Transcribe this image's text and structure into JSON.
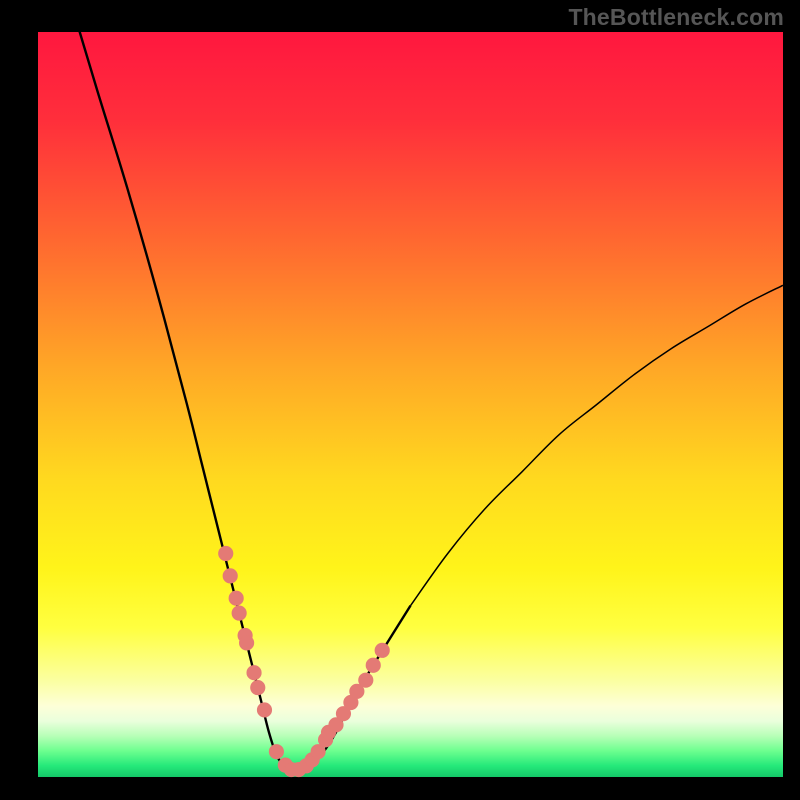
{
  "watermark": {
    "text": "TheBottleneck.com"
  },
  "colors": {
    "background": "#000000",
    "gradient_stops": [
      {
        "pos": 0.0,
        "color": "#ff173f"
      },
      {
        "pos": 0.12,
        "color": "#ff2f3b"
      },
      {
        "pos": 0.28,
        "color": "#ff6830"
      },
      {
        "pos": 0.45,
        "color": "#ffa726"
      },
      {
        "pos": 0.6,
        "color": "#ffd91f"
      },
      {
        "pos": 0.72,
        "color": "#fff41a"
      },
      {
        "pos": 0.8,
        "color": "#ffff40"
      },
      {
        "pos": 0.87,
        "color": "#fbffa0"
      },
      {
        "pos": 0.905,
        "color": "#fdffd8"
      },
      {
        "pos": 0.925,
        "color": "#eaffdc"
      },
      {
        "pos": 0.945,
        "color": "#b7ffb7"
      },
      {
        "pos": 0.965,
        "color": "#6dff8f"
      },
      {
        "pos": 0.985,
        "color": "#25e97a"
      },
      {
        "pos": 1.0,
        "color": "#14c768"
      }
    ],
    "curve": "#000000",
    "marker_fill": "#e47a75",
    "marker_stroke": "#e47a75"
  },
  "chart_data": {
    "type": "line",
    "title": "",
    "xlabel": "",
    "ylabel": "",
    "xlim": [
      0,
      100
    ],
    "ylim": [
      0,
      100
    ],
    "grid": false,
    "legend": false,
    "series": [
      {
        "name": "bottleneck-curve",
        "x": [
          5,
          8,
          12,
          16,
          20,
          22,
          24,
          26,
          28,
          29,
          30,
          31,
          32,
          33,
          34,
          35,
          36,
          38,
          40,
          42,
          45,
          50,
          55,
          60,
          65,
          70,
          75,
          80,
          85,
          90,
          95,
          100
        ],
        "y": [
          102,
          92,
          79,
          65,
          50,
          42,
          34,
          26,
          18,
          14,
          10,
          6,
          3,
          1.5,
          1,
          1,
          1.5,
          3,
          6,
          10,
          15,
          23,
          30,
          36,
          41,
          46,
          50,
          54,
          57.5,
          60.5,
          63.5,
          66
        ],
        "note": "y is the curve height as percent of plot-area height measured from the bottom; values are visual estimates"
      }
    ],
    "markers": {
      "name": "highlighted-points",
      "x": [
        25.2,
        25.8,
        26.6,
        27.0,
        27.8,
        28.0,
        29.0,
        29.5,
        30.4,
        32.0,
        33.2,
        34.0,
        35.0,
        36.0,
        36.8,
        37.6,
        38.6,
        39.0,
        40.0,
        41.0,
        42.0,
        42.8,
        44.0,
        45.0,
        46.2
      ],
      "y": [
        30.0,
        27.0,
        24.0,
        22.0,
        19.0,
        18.0,
        14.0,
        12.0,
        9.0,
        3.4,
        1.6,
        1.0,
        1.0,
        1.5,
        2.3,
        3.4,
        5.0,
        6.0,
        7.0,
        8.5,
        10.0,
        11.5,
        13.0,
        15.0,
        17.0
      ],
      "radius_percent": 0.95
    }
  }
}
